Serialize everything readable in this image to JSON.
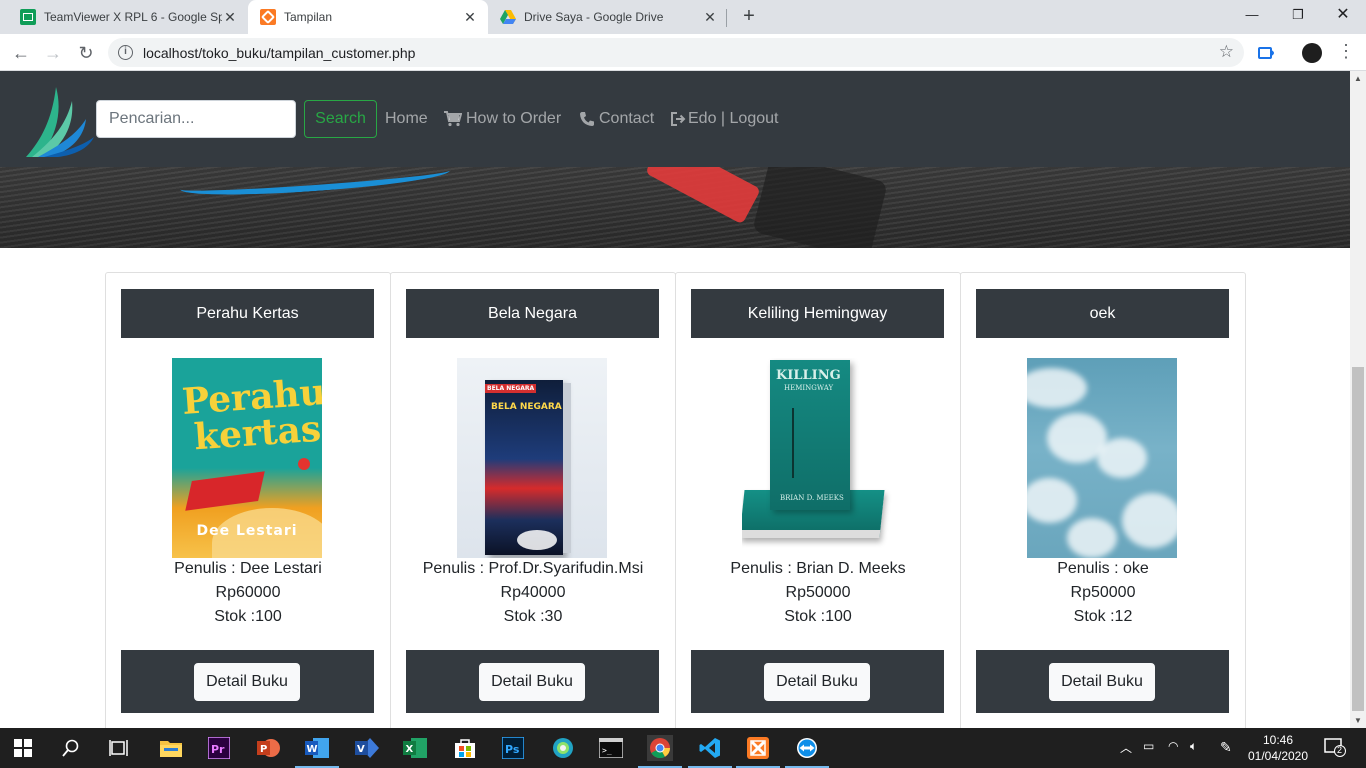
{
  "browser": {
    "tabs": [
      {
        "title": "TeamViewer X RPL 6 - Google Sp",
        "icon": "google-sheets-icon",
        "active": false
      },
      {
        "title": "Tampilan",
        "icon": "xampp-icon",
        "active": true
      },
      {
        "title": "Drive Saya - Google Drive",
        "icon": "google-drive-icon",
        "active": false
      }
    ],
    "url": "localhost/toko_buku/tampilan_customer.php"
  },
  "navbar": {
    "search_placeholder": "Pencarian...",
    "search_button": "Search",
    "links": [
      {
        "label": "Home",
        "icon": ""
      },
      {
        "label": "How to Order",
        "icon": "shopping-cart-icon"
      },
      {
        "label": "Contact",
        "icon": "phone-icon"
      },
      {
        "label": "Edo | Logout",
        "icon": "sign-out-icon"
      }
    ]
  },
  "books": [
    {
      "title": "Perahu Kertas",
      "author": "Penulis : Dee Lestari",
      "price": "Rp60000",
      "stock": "Stok :100",
      "button": "Detail Buku"
    },
    {
      "title": "Bela Negara",
      "author": "Penulis : Prof.Dr.Syarifudin.Msi",
      "price": "Rp40000",
      "stock": "Stok :30",
      "button": "Detail Buku"
    },
    {
      "title": "Keliling Hemingway",
      "author": "Penulis : Brian D. Meeks",
      "price": "Rp50000",
      "stock": "Stok :100",
      "button": "Detail Buku"
    },
    {
      "title": "oek",
      "author": "Penulis : oke",
      "price": "Rp50000",
      "stock": "Stok :12",
      "button": "Detail Buku"
    }
  ],
  "covers": {
    "perahu": {
      "line1": "Perahu",
      "line2": "kertas",
      "author": "Dee Lestari"
    },
    "bela": {
      "tag": "BELA NEGARA",
      "title": "BELA NEGARA"
    },
    "killing": {
      "title": "KILLING",
      "subtitle": "HEMINGWAY",
      "author": "BRIAN D. MEEKS"
    }
  },
  "taskbar": {
    "time": "10:46",
    "date": "01/04/2020",
    "notifications": "2"
  },
  "colors": {
    "navbar": "#343a40",
    "search_green": "#28a745",
    "card_header": "#343a40"
  }
}
